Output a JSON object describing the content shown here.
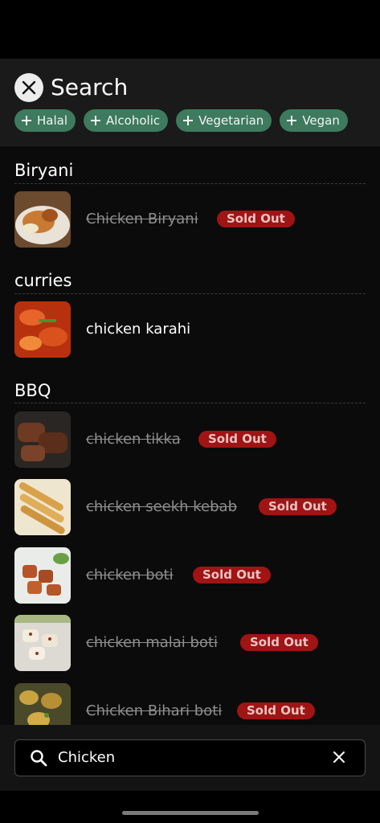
{
  "header": {
    "title": "Search",
    "filters": [
      {
        "label": "Halal"
      },
      {
        "label": "Alcoholic"
      },
      {
        "label": "Vegetarian"
      },
      {
        "label": "Vegan"
      }
    ]
  },
  "sections": [
    {
      "title": "Biryani",
      "items": [
        {
          "name": "Chicken Biryani",
          "sold_out": true,
          "badge": "Sold Out"
        }
      ]
    },
    {
      "title": "curries",
      "items": [
        {
          "name": "chicken karahi",
          "sold_out": false
        }
      ]
    },
    {
      "title": "BBQ",
      "items": [
        {
          "name": "chicken tikka",
          "sold_out": true,
          "badge": "Sold Out"
        },
        {
          "name": "chicken seekh kebab",
          "sold_out": true,
          "badge": "Sold Out"
        },
        {
          "name": "chicken boti",
          "sold_out": true,
          "badge": "Sold Out"
        },
        {
          "name": "chicken malai boti",
          "sold_out": true,
          "badge": "Sold Out"
        },
        {
          "name": "Chicken Bihari boti",
          "sold_out": true,
          "badge": "Sold Out"
        }
      ]
    }
  ],
  "search": {
    "value": "Chicken"
  },
  "colors": {
    "chip_bg": "#3d7a5e",
    "badge_bg": "#a01414",
    "background": "#0b0b0b"
  },
  "icons": {
    "close": "close-icon",
    "plus": "plus-icon",
    "search": "search-icon",
    "clear": "clear-icon"
  }
}
